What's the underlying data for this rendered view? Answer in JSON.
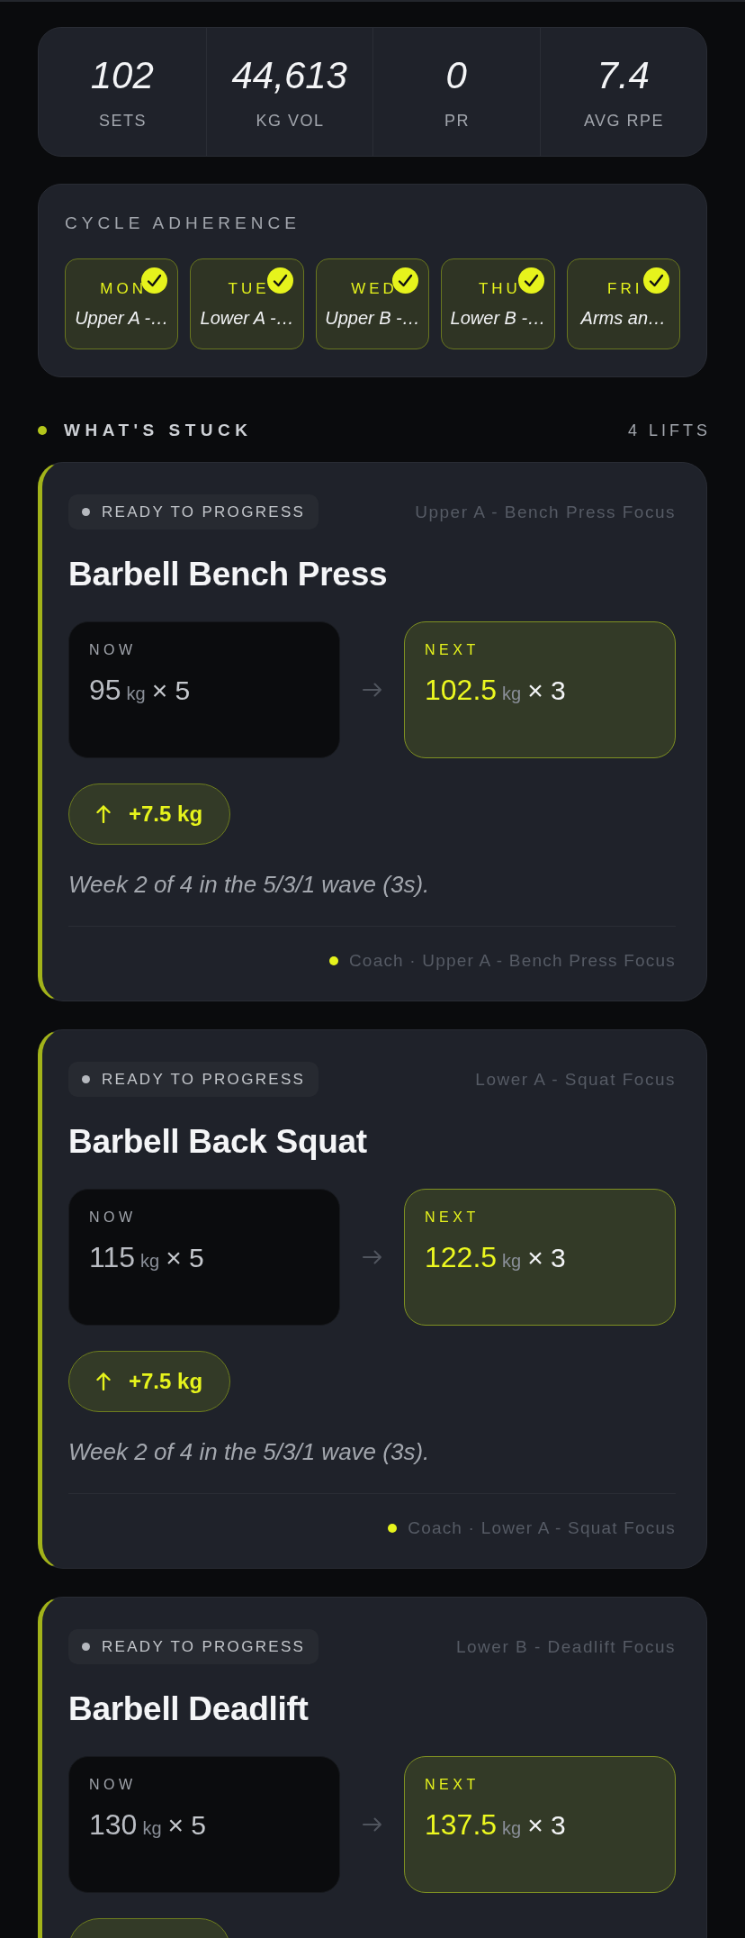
{
  "stats": [
    {
      "value": "102",
      "label": "SETS"
    },
    {
      "value": "44,613",
      "label": "KG VOL"
    },
    {
      "value": "0",
      "label": "PR"
    },
    {
      "value": "7.4",
      "label": "AVG RPE"
    }
  ],
  "cycle_adherence": {
    "title": "CYCLE ADHERENCE",
    "days": [
      {
        "day": "MON",
        "workout": "Upper A -…",
        "done": true
      },
      {
        "day": "TUE",
        "workout": "Lower A -…",
        "done": true
      },
      {
        "day": "WED",
        "workout": "Upper B -…",
        "done": true
      },
      {
        "day": "THU",
        "workout": "Lower B -…",
        "done": true
      },
      {
        "day": "FRI",
        "workout": "Arms an…",
        "done": true
      }
    ]
  },
  "stuck": {
    "title": "WHAT'S STUCK",
    "count": "4 LIFTS",
    "lifts": [
      {
        "status": "READY TO PROGRESS",
        "session": "Upper A - Bench Press Focus",
        "name": "Barbell Bench Press",
        "now": {
          "label": "NOW",
          "weight": "95",
          "unit": "kg",
          "reps": "× 5"
        },
        "next": {
          "label": "NEXT",
          "weight": "102.5",
          "unit": "kg",
          "reps": "× 3"
        },
        "change_pill": true,
        "change": "+7.5 kg",
        "note": "Week 2 of 4 in the 5/3/1 wave (3s).",
        "footer": "Coach · Upper A - Bench Press Focus"
      },
      {
        "status": "READY TO PROGRESS",
        "session": "Lower A - Squat Focus",
        "name": "Barbell Back Squat",
        "now": {
          "label": "NOW",
          "weight": "115",
          "unit": "kg",
          "reps": "× 5"
        },
        "next": {
          "label": "NEXT",
          "weight": "122.5",
          "unit": "kg",
          "reps": "× 3"
        },
        "change_pill": true,
        "change": "+7.5 kg",
        "note": "Week 2 of 4 in the 5/3/1 wave (3s).",
        "footer": "Coach · Lower A - Squat Focus"
      },
      {
        "status": "READY TO PROGRESS",
        "session": "Lower B - Deadlift Focus",
        "name": "Barbell Deadlift",
        "now": {
          "label": "NOW",
          "weight": "130",
          "unit": "kg",
          "reps": "× 5"
        },
        "next": {
          "label": "NEXT",
          "weight": "137.5",
          "unit": "kg",
          "reps": "× 3"
        },
        "change_pill": true
      }
    ]
  }
}
